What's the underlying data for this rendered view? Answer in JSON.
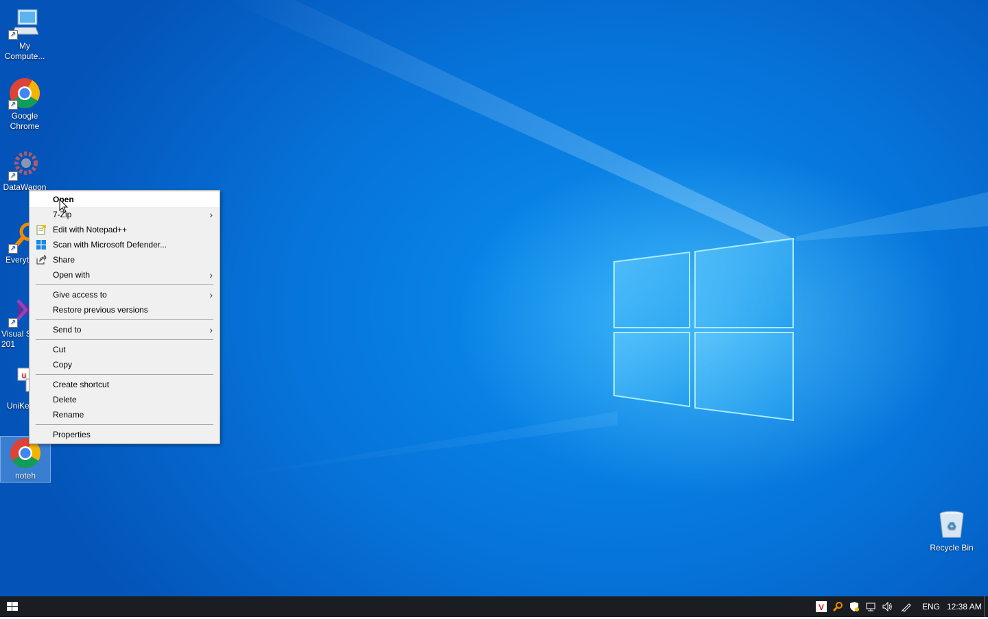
{
  "desktop_icons": [
    {
      "label": "My\nCompute...",
      "icon": "computer-icon"
    },
    {
      "label": "Google\nChrome",
      "icon": "chrome-icon"
    },
    {
      "label": "DataWagon",
      "icon": "datawagon-icon"
    },
    {
      "label": "Everyt",
      "icon": "everything-search-icon"
    },
    {
      "label": "Visual S\n201",
      "icon": "visual-studio-icon"
    },
    {
      "label": "UniKe",
      "icon": "unikey-icon"
    },
    {
      "label": "noteh",
      "icon": "chrome-icon"
    },
    {
      "label": "Recycle Bin",
      "icon": "recycle-bin-icon"
    }
  ],
  "context_menu": {
    "items": [
      {
        "label": "Open",
        "bold": true,
        "hover": true
      },
      {
        "label": "7-Zip",
        "submenu": true
      },
      {
        "label": "Edit with Notepad++",
        "icon": "notepad-plus-plus-icon"
      },
      {
        "label": "Scan with Microsoft Defender...",
        "icon": "defender-icon"
      },
      {
        "label": "Share",
        "icon": "share-icon"
      },
      {
        "label": "Open with",
        "submenu": true
      },
      {
        "label": "Give access to",
        "submenu": true
      },
      {
        "label": "Restore previous versions"
      },
      {
        "label": "Send to",
        "submenu": true
      },
      {
        "label": "Cut"
      },
      {
        "label": "Copy"
      },
      {
        "label": "Create shortcut"
      },
      {
        "label": "Delete"
      },
      {
        "label": "Rename"
      },
      {
        "label": "Properties"
      }
    ],
    "submenu_arrow": "›"
  },
  "taskbar": {
    "language": "ENG",
    "clock": "12:38 AM",
    "tray_icons": [
      "vivaldi-icon",
      "search-tool-icon",
      "security-shield-icon",
      "network-icon",
      "volume-icon",
      "pen-icon"
    ]
  },
  "colors": {
    "taskbar": "#1a1d22",
    "menu_bg": "#f0f0f0",
    "menu_hover": "#ffffff",
    "desktop_blue": "#0673d9"
  }
}
